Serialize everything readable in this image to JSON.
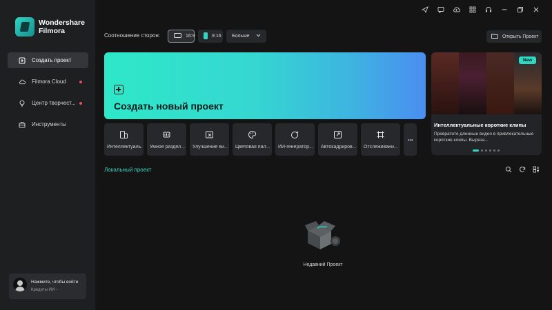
{
  "app": {
    "brand_line1": "Wondershare",
    "brand_line2": "Filmora"
  },
  "sidebar": {
    "items": [
      {
        "label": "Создать проект",
        "icon": "new-project-icon",
        "active": true
      },
      {
        "label": "Filmora Cloud",
        "icon": "cloud-icon",
        "dot": true
      },
      {
        "label": "Центр творчест...",
        "icon": "creative-center-icon",
        "dot": true
      },
      {
        "label": "Инструменты",
        "icon": "toolbox-icon"
      }
    ],
    "login": {
      "title": "Нажмите, чтобы войти",
      "credits": "Кредиты ИИ -"
    }
  },
  "topbar": {
    "icons": [
      "send-icon",
      "message-icon",
      "cloud-upload-icon",
      "grid-icon",
      "headset-icon",
      "minimize-icon",
      "restore-icon",
      "close-icon"
    ]
  },
  "aspect": {
    "label": "Соотношение сторон:",
    "options": [
      "16:9",
      "9:16"
    ],
    "more": "Больше",
    "selected": "16:9"
  },
  "open_project": "Открыть Проект",
  "create": {
    "title": "Создать новый проект"
  },
  "tools": [
    {
      "label": "Интеллектуаль...",
      "icon": "smart-clip-icon"
    },
    {
      "label": "Умное раздел...",
      "icon": "split-icon"
    },
    {
      "label": "Улучшение ви...",
      "icon": "enhance-icon"
    },
    {
      "label": "Цветовая пал...",
      "icon": "palette-icon"
    },
    {
      "label": "ИИ-генератор...",
      "icon": "ai-generator-icon"
    },
    {
      "label": "Автокадриров...",
      "icon": "auto-reframe-icon"
    },
    {
      "label": "Отслеживани...",
      "icon": "tracking-icon"
    },
    {
      "label": "...",
      "icon": "more-icon"
    }
  ],
  "promo": {
    "badge": "New",
    "title": "Интеллектуальные короткие клипы",
    "desc": "Превратите длинные видео в привлекательные короткие клипы. Выреза...",
    "dots_total": 6,
    "active_dot": 0
  },
  "local": {
    "title": "Локальный проект",
    "empty_label": "Недавний Проект",
    "icons": [
      "search-icon",
      "refresh-icon",
      "view-toggle-icon"
    ]
  },
  "colors": {
    "accent": "#2fd7c4",
    "bg": "#141414",
    "sidebar": "#1e1f21",
    "dot": "#f04a5a"
  }
}
